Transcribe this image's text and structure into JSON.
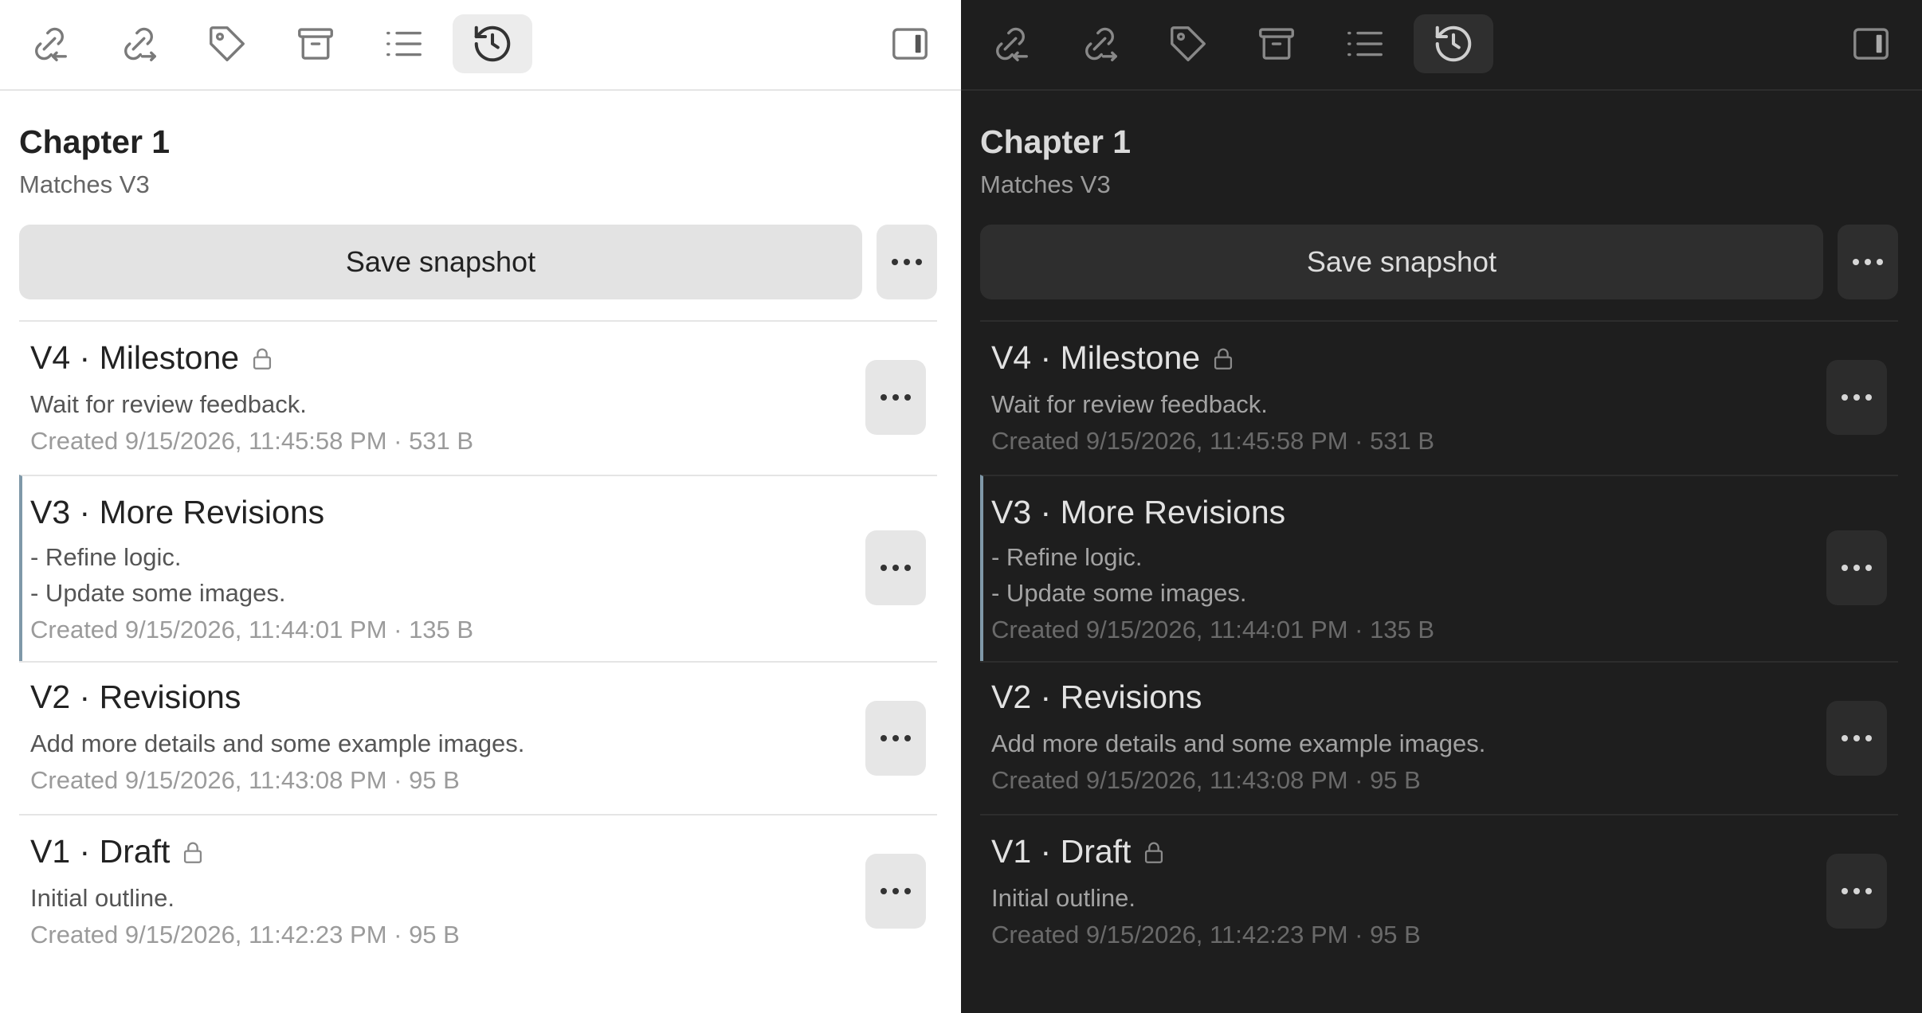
{
  "title": "Chapter 1",
  "subtitle": "Matches V3",
  "save_label": "Save snapshot",
  "toolbar": [
    "link-in-icon",
    "link-out-icon",
    "tag-icon",
    "archive-icon",
    "list-icon",
    "history-icon",
    "sidebar-toggle-icon"
  ],
  "items": [
    {
      "title": "V4 · Milestone",
      "locked": true,
      "desc": [
        "Wait for review feedback."
      ],
      "meta": "Created 9/15/2026, 11:45:58 PM · 531 B",
      "current": false
    },
    {
      "title": "V3 · More Revisions",
      "locked": false,
      "desc": [
        "- Refine logic.",
        "- Update some images."
      ],
      "meta": "Created 9/15/2026, 11:44:01 PM · 135 B",
      "current": true
    },
    {
      "title": "V2 · Revisions",
      "locked": false,
      "desc": [
        "Add more details and some example images."
      ],
      "meta": "Created 9/15/2026, 11:43:08 PM · 95 B",
      "current": false
    },
    {
      "title": "V1 · Draft",
      "locked": true,
      "desc": [
        "Initial outline."
      ],
      "meta": "Created 9/15/2026, 11:42:23 PM · 95 B",
      "current": false
    }
  ],
  "colors": {
    "light_bg": "#ffffff",
    "dark_bg": "#1e1e1e",
    "current_marker": "#7f98a8"
  }
}
